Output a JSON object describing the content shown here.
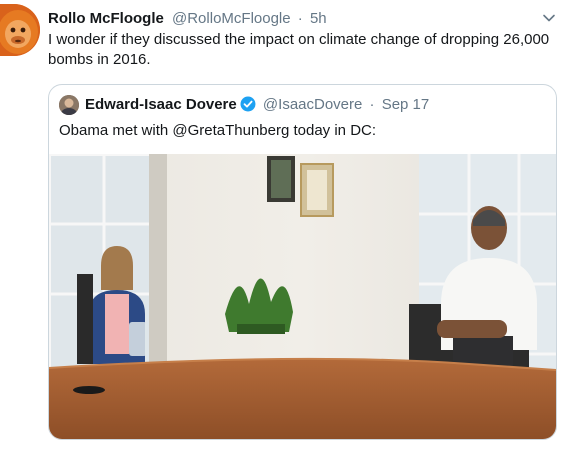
{
  "tweet": {
    "display_name": "Rollo McFloogle",
    "handle": "@RolloMcFloogle",
    "separator": "·",
    "time": "5h",
    "text": "I wonder if they discussed the impact on climate change of dropping 26,000 bombs in 2016."
  },
  "quoted_tweet": {
    "display_name": "Edward-Isaac Dovere",
    "handle": "@IsaacDovere",
    "separator": "·",
    "time": "Sep 17",
    "text": "Obama met with @GretaThunberg today in DC:"
  },
  "colors": {
    "text_primary": "#14171a",
    "text_secondary": "#657786",
    "verified_blue": "#1da1f2",
    "border": "#ccd6dd"
  },
  "icons": {
    "avatar": "orangutan-avatar-icon",
    "caret": "chevron-down-icon",
    "verified": "verified-badge-icon"
  }
}
